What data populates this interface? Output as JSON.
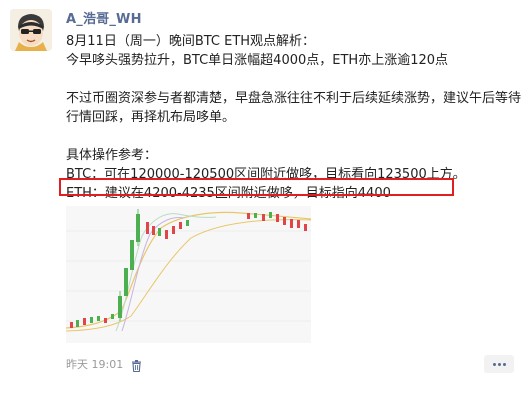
{
  "post": {
    "author": "A_浩哥_WH",
    "lines": [
      "8月11日（周一）晚间BTC ETH观点解析：",
      "今早哆头强势拉升，BTC单日涨幅超4000点，ETH亦上涨逾120点",
      "",
      "不过币圈资深参与者都清楚，早盘急涨往往不利于后续延续涨势，建议午后等待行情回踩，再择机布局哆单。",
      "",
      "具体操作参考：",
      "BTC：可在120000-120500区间附近做哆，目标看向123500上方。",
      "ETH：建议在4200-4235区间附近做哆，目标指向4400"
    ],
    "highlight_color": "#e02020",
    "time": "昨天 19:01",
    "delete_icon": "trash-icon",
    "more_icon": "ellipsis-icon",
    "link_color": "#576b95"
  }
}
